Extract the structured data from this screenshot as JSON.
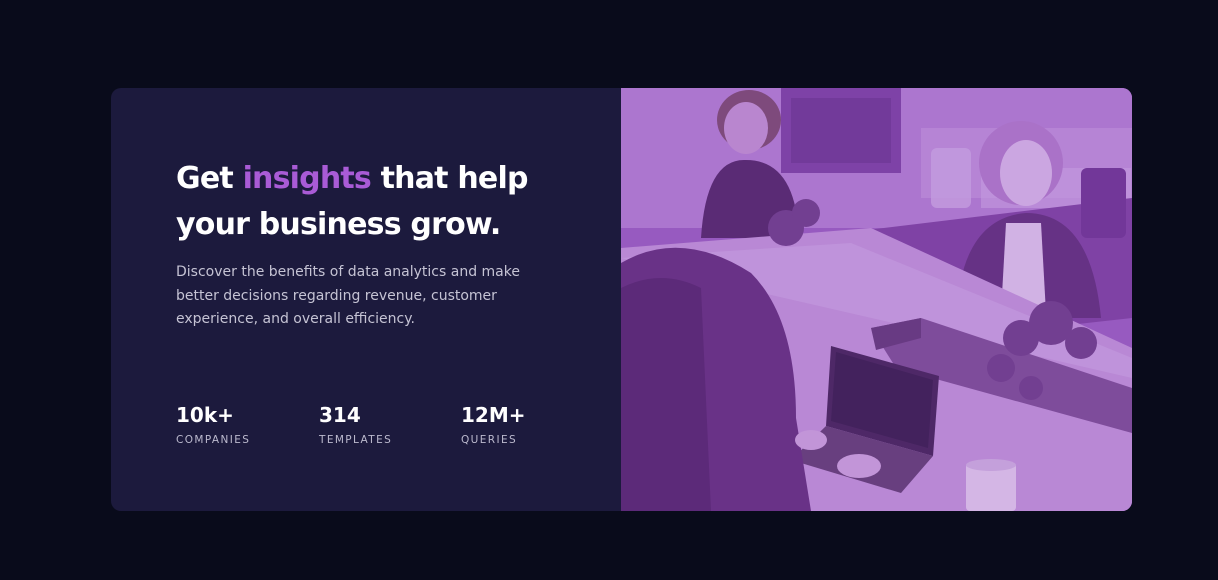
{
  "hero": {
    "headline_before": "Get ",
    "headline_accent": "insights",
    "headline_after": " that help your business grow.",
    "description": "Discover the benefits of data analytics and make better decisions regarding revenue, customer experience, and overall efficiency."
  },
  "stats": [
    {
      "value": "10k+",
      "label": "COMPANIES"
    },
    {
      "value": "314",
      "label": "TEMPLATES"
    },
    {
      "value": "12M+",
      "label": "QUERIES"
    }
  ],
  "colors": {
    "page_background": "#090b1b",
    "card_background": "#1c1a3d",
    "accent": "#a95bd6",
    "image_overlay": "#8a4bb3"
  },
  "image": {
    "icon": "office-team-photo"
  }
}
